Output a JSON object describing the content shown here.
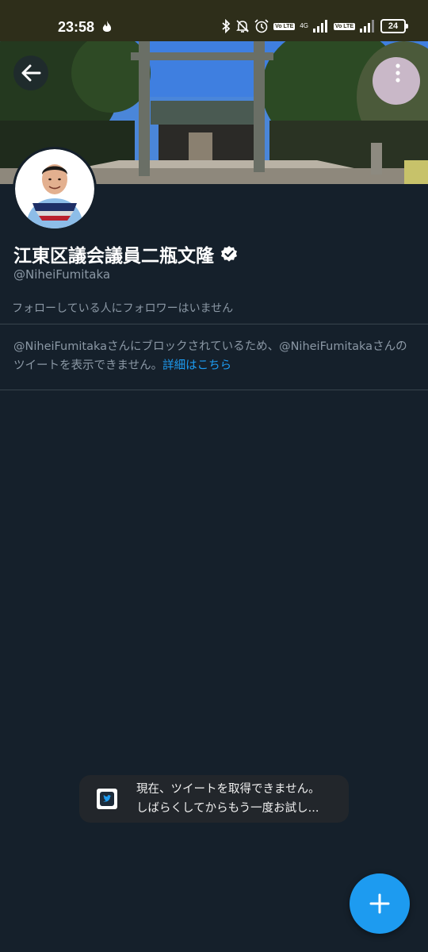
{
  "status_bar": {
    "time": "23:58",
    "battery": "24",
    "net_4g": "4G",
    "volte_1": "Vo LTE",
    "volte_2": "Vo LTE"
  },
  "profile": {
    "display_name": "江東区議会議員二瓶文隆",
    "handle": "@NiheiFumitaka",
    "followers_note": "フォローしている人にフォロワーはいません",
    "blocked_message": "@NiheiFumitakaさんにブロックされているため、@NiheiFumitakaさんのツイートを表示できません。",
    "learn_more_link": "詳細はこちら",
    "verified": true
  },
  "toast": {
    "line1": "現在、ツイートを取得できません。",
    "line2": "しばらくしてからもう一度お試し..."
  },
  "icons": {
    "back": "arrow-left-icon",
    "more": "more-vertical-icon",
    "compose": "plus-icon",
    "verified": "verified-badge-icon",
    "app": "twitter-app-icon"
  },
  "colors": {
    "background": "#15202b",
    "accent": "#1d9bf0",
    "secondary_text": "#8b98a5",
    "divider": "#38444d"
  }
}
